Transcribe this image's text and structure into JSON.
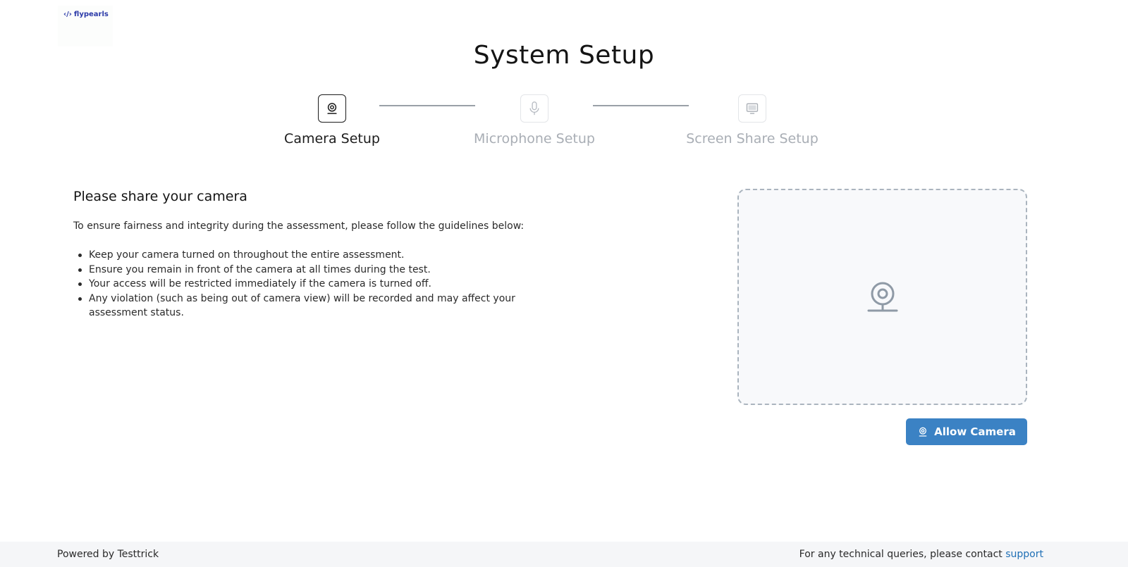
{
  "brand": {
    "logo_text": "flypearls",
    "logo_icon": "code-bracket-icon",
    "brand_color": "#2b3aa8"
  },
  "page": {
    "title": "System Setup"
  },
  "steps": [
    {
      "label": "Camera Setup",
      "icon": "webcam-icon",
      "state": "active"
    },
    {
      "label": "Microphone Setup",
      "icon": "microphone-icon",
      "state": "inactive"
    },
    {
      "label": "Screen Share Setup",
      "icon": "monitor-icon",
      "state": "inactive"
    }
  ],
  "content": {
    "heading": "Please share your camera",
    "intro": "To ensure fairness and integrity during the assessment, please follow the guidelines below:",
    "rules": [
      "Keep your camera turned on throughout the entire assessment.",
      "Ensure you remain in front of the camera at all times during the test.",
      "Your access will be restricted immediately if the camera is turned off.",
      "Any violation (such as being out of camera view) will be recorded and may affect your assessment status."
    ]
  },
  "preview": {
    "icon": "webcam-icon"
  },
  "actions": {
    "allow_camera_label": "Allow Camera",
    "accent_color": "#3b82c4"
  },
  "footer": {
    "powered_by": "Powered by Testtrick",
    "support_prefix": "For any technical queries, please contact ",
    "support_link": "support"
  }
}
